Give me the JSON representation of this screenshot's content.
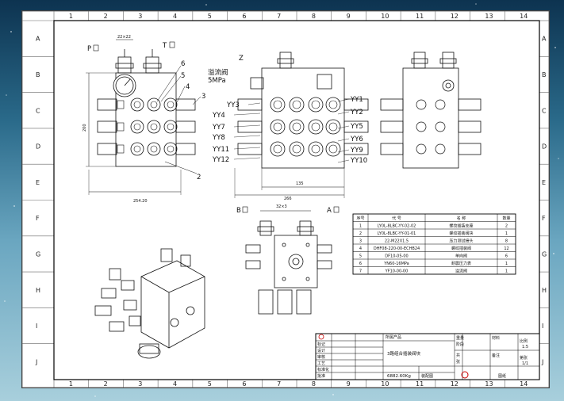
{
  "zones": {
    "cols": [
      "1",
      "2",
      "3",
      "4",
      "5",
      "6",
      "7",
      "8",
      "9",
      "10",
      "11",
      "12",
      "13",
      "14"
    ],
    "rows": [
      "A",
      "B",
      "C",
      "D",
      "E",
      "F",
      "G",
      "H",
      "I",
      "J"
    ]
  },
  "front_view": {
    "port_p": "P",
    "port_t": "T",
    "dim_top": "22×22",
    "dim_height": "200",
    "dim_width": "254.20",
    "balloons": [
      "6",
      "5",
      "4",
      "3",
      "2"
    ]
  },
  "middle_view": {
    "relief_valve": "溢流阀",
    "relief_pressure": "5MPa",
    "item_z": "Z",
    "left_labels": [
      "YY3",
      "YY4",
      "YY7",
      "YY8",
      "YY11",
      "YY12"
    ],
    "right_labels": [
      "YY1",
      "YY2",
      "YY5",
      "YY6",
      "YY9",
      "YY10"
    ],
    "dim_inner": "135",
    "dim_outer": "266"
  },
  "bottom_view": {
    "port_b": "B",
    "port_a": "A",
    "dim_top": "32×3"
  },
  "bom": {
    "headers": [
      "序号",
      "代  号",
      "名  称",
      "数量"
    ],
    "rows": [
      [
        "1",
        "LY0L-8LBC-YY-02-02",
        "螺纹插装支座",
        "2"
      ],
      [
        "2",
        "LY0L-8LBC-YY-01-01",
        "螺纹插装阀块",
        "1"
      ],
      [
        "3",
        "22-M22X1.5",
        "压力测试接头",
        "8"
      ],
      [
        "4",
        "DHF08-220-00-ECHB24",
        "螺纹插装阀",
        "12"
      ],
      [
        "5",
        "DF10-05-00",
        "单向阀",
        "6"
      ],
      [
        "6",
        "YN60-16MPa",
        "耐震压力表",
        "1"
      ],
      [
        "7",
        "YF10-00-00",
        "溢流阀",
        "1"
      ]
    ]
  },
  "title_block": {
    "company": "所属产品",
    "drawing_name": "3路组合插装阀块",
    "weight": "6882.60Kg",
    "scale_label": "比例",
    "scale_value": "1:5",
    "sheet_label": "第张",
    "sheet_value": "1/1",
    "cells": [
      "标记",
      "设计",
      "审核",
      "工艺",
      "标准化",
      "批准",
      "重量",
      "阶段",
      "共",
      "张",
      "材料",
      "备注",
      "装配图",
      "图纸"
    ]
  }
}
